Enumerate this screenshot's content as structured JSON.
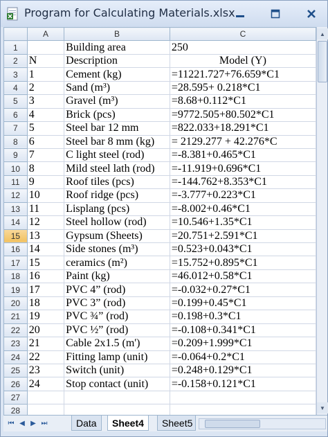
{
  "window": {
    "title": "Program for Calculating Materials.xlsx",
    "icon": "excel-file-icon"
  },
  "columns": [
    "A",
    "B",
    "C"
  ],
  "rows": [
    {
      "n": "1",
      "a": "",
      "b": "Building area",
      "c": "250"
    },
    {
      "n": "2",
      "a": "N",
      "b": "Description",
      "c": "Model (Y)"
    },
    {
      "n": "3",
      "a": "1",
      "b": "Cement (kg)",
      "c": "=11221.727+76.659*C1"
    },
    {
      "n": "4",
      "a": "2",
      "b": "Sand (m³)",
      "c": "=28.595+ 0.218*C1"
    },
    {
      "n": "5",
      "a": "3",
      "b": "Gravel (m³)",
      "c": "=8.68+0.112*C1"
    },
    {
      "n": "6",
      "a": "4",
      "b": "Brick (pcs)",
      "c": "=9772.505+80.502*C1"
    },
    {
      "n": "7",
      "a": "5",
      "b": "Steel bar 12 mm",
      "c": "=822.033+18.291*C1"
    },
    {
      "n": "8",
      "a": "6",
      "b": "Steel bar 8 mm (kg)",
      "c": "= 2129.277 + 42.276*C"
    },
    {
      "n": "9",
      "a": "7",
      "b": "C light steel (rod)",
      "c": "=-8.381+0.465*C1"
    },
    {
      "n": "10",
      "a": "8",
      "b": "Mild steel lath (rod)",
      "c": "=-11.919+0.696*C1"
    },
    {
      "n": "11",
      "a": "9",
      "b": "Roof tiles (pcs)",
      "c": "=-144.762+8.353*C1"
    },
    {
      "n": "12",
      "a": "10",
      "b": "Roof ridge  (pcs)",
      "c": "=-3.777+0.223*C1"
    },
    {
      "n": "13",
      "a": "11",
      "b": "Lisplang (pcs)",
      "c": "=-8.002+0.46*C1"
    },
    {
      "n": "14",
      "a": "12",
      "b": "Steel hollow (rod)",
      "c": "=10.546+1.35*C1"
    },
    {
      "n": "15",
      "a": "13",
      "b": "Gypsum (Sheets)",
      "c": "=20.751+2.591*C1"
    },
    {
      "n": "16",
      "a": "14",
      "b": "Side stones (m³)",
      "c": "=0.523+0.043*C1"
    },
    {
      "n": "17",
      "a": "15",
      "b": "ceramics (m²)",
      "c": "=15.752+0.895*C1"
    },
    {
      "n": "18",
      "a": "16",
      "b": "Paint (kg)",
      "c": "=46.012+0.58*C1"
    },
    {
      "n": "19",
      "a": "17",
      "b": "PVC 4” (rod)",
      "c": "=-0.032+0.27*C1"
    },
    {
      "n": "20",
      "a": "18",
      "b": "PVC 3” (rod)",
      "c": "=0.199+0.45*C1"
    },
    {
      "n": "21",
      "a": "19",
      "b": "PVC ¾” (rod)",
      "c": "=0.198+0.3*C1"
    },
    {
      "n": "22",
      "a": "20",
      "b": "PVC ½” (rod)",
      "c": "=-0.108+0.341*C1"
    },
    {
      "n": "23",
      "a": "21",
      "b": "Cable 2x1.5 (m')",
      "c": "=0.209+1.999*C1"
    },
    {
      "n": "24",
      "a": "22",
      "b": "Fitting lamp (unit)",
      "c": "=-0.064+0.2*C1"
    },
    {
      "n": "25",
      "a": "23",
      "b": "Switch (unit)",
      "c": "=0.248+0.129*C1"
    },
    {
      "n": "26",
      "a": "24",
      "b": "Stop contact (unit)",
      "c": "=-0.158+0.121*C1"
    },
    {
      "n": "27",
      "a": "",
      "b": "",
      "c": ""
    },
    {
      "n": "28",
      "a": "",
      "b": "",
      "c": ""
    }
  ],
  "selected_row": "15",
  "sheet_tabs": [
    "Data",
    "Sheet4",
    "Sheet5"
  ],
  "active_tab": "Sheet4",
  "colors": {
    "header_bg": "#dde6f3",
    "selected_row_header": "#f1c15f",
    "grid_line": "#d0d7e5"
  }
}
